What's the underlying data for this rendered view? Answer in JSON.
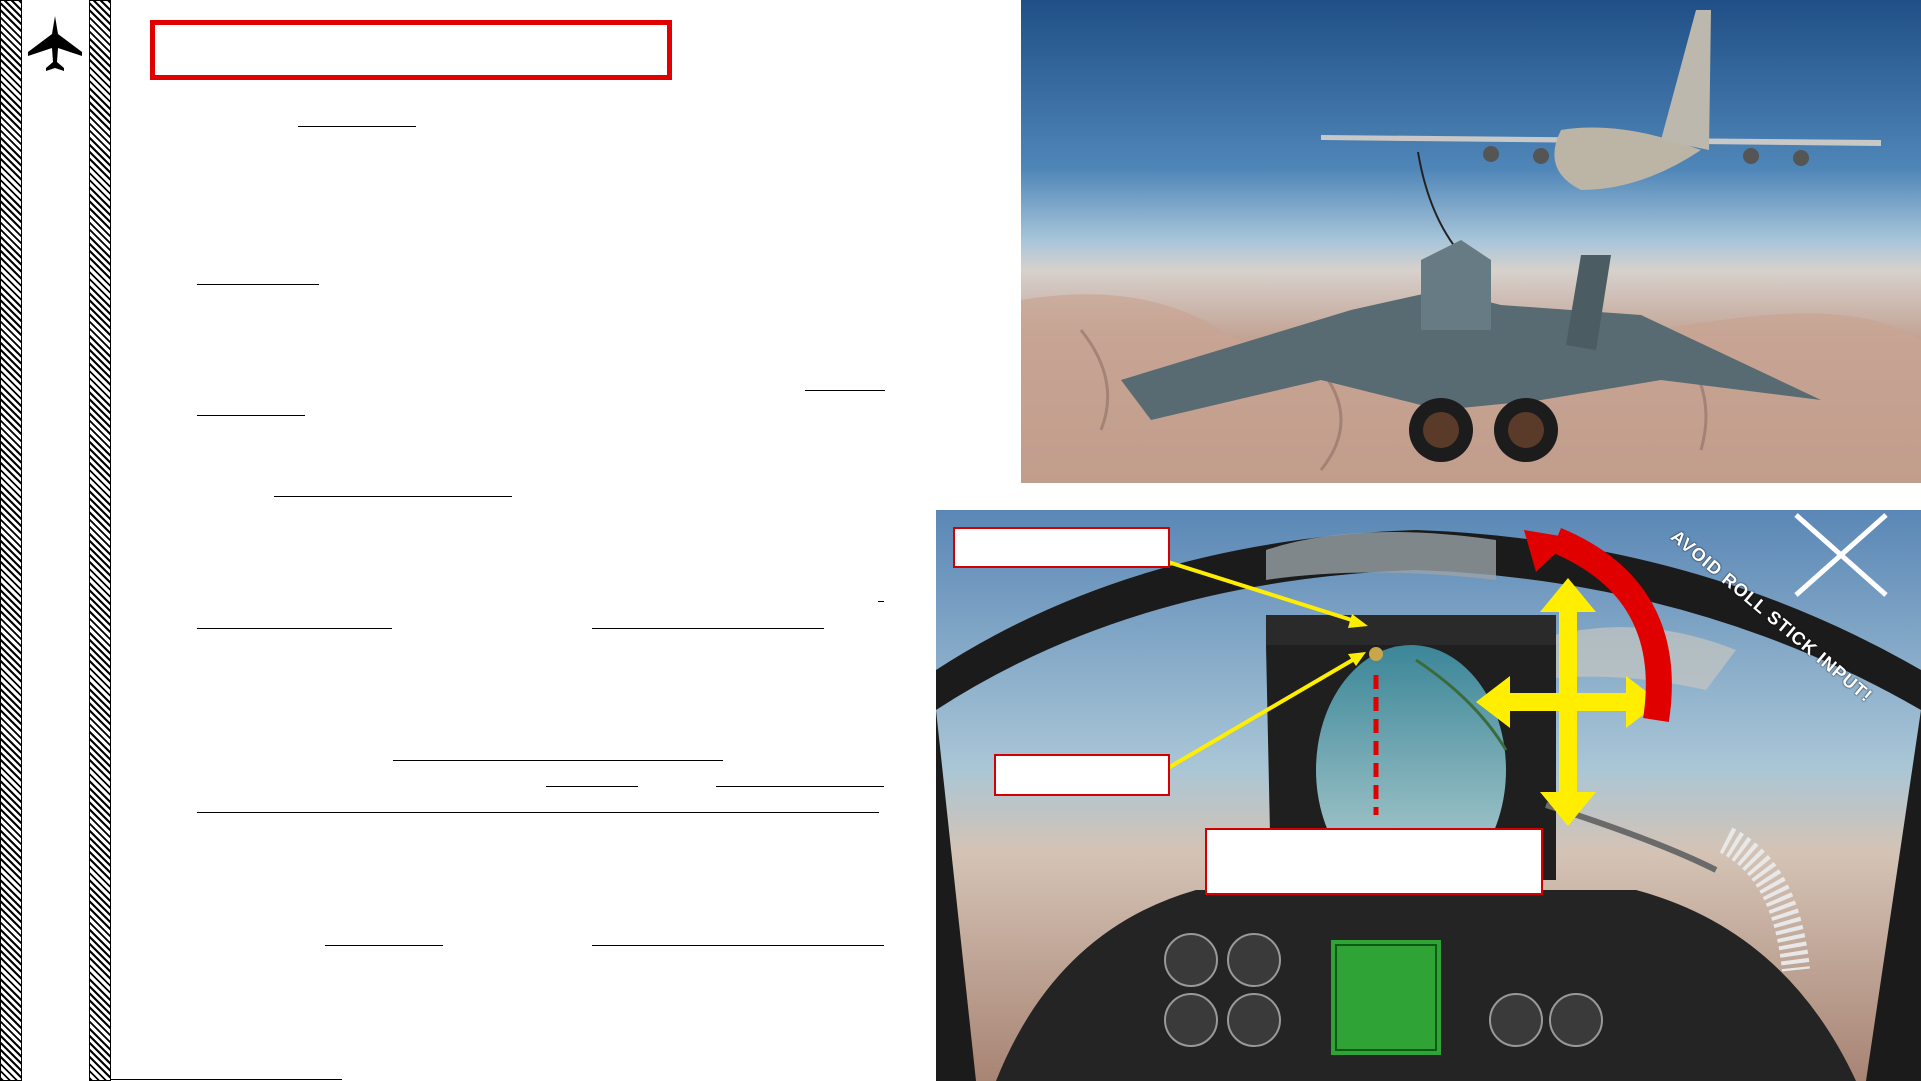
{
  "sidebar": {
    "icon": "fighter-jet-icon"
  },
  "title_box": {
    "text": ""
  },
  "top_photo": {
    "alt_icon": "refueling-photo"
  },
  "cockpit_photo": {
    "roll_warning": "AVOID ROLL STICK INPUT!",
    "callout_top_left": "",
    "callout_left": "",
    "callout_bottom": ""
  },
  "footer": {
    "text": ""
  },
  "colors": {
    "accent": "#e00000",
    "arrow": "#ffee00",
    "frame": "#000000"
  }
}
